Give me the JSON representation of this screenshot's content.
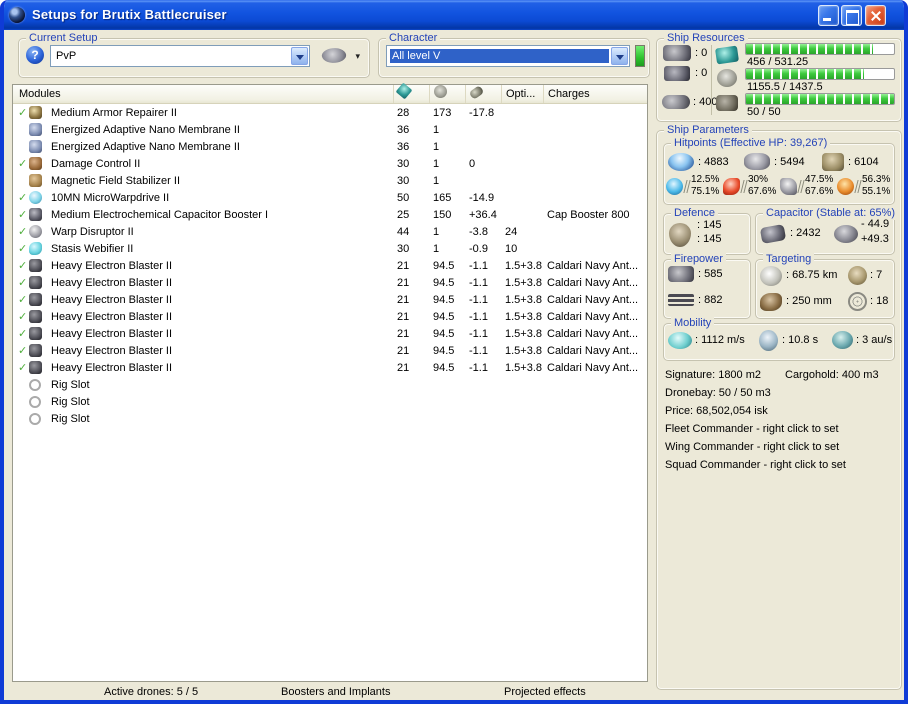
{
  "glyphs": {
    "help": "?",
    "check": "✓",
    "caret": "▾"
  },
  "window": {
    "title": "Setups for Brutix Battlecruiser"
  },
  "current_setup": {
    "label": "Current Setup",
    "value": "PvP"
  },
  "character": {
    "label": "Character",
    "value": "All level V"
  },
  "modules_table": {
    "header": {
      "modules": "Modules",
      "opti": "Opti...",
      "charges": "Charges"
    },
    "rows": [
      {
        "fitted": true,
        "icon": "armor-repairer",
        "name": "Medium Armor Repairer II",
        "cpu": "28",
        "pg": "173",
        "cap": "-17.8",
        "opti": "",
        "charge": ""
      },
      {
        "fitted": false,
        "icon": "nano-membrane",
        "name": "Energized Adaptive Nano Membrane II",
        "cpu": "36",
        "pg": "1",
        "cap": "",
        "opti": "",
        "charge": ""
      },
      {
        "fitted": false,
        "icon": "nano-membrane",
        "name": "Energized Adaptive Nano Membrane II",
        "cpu": "36",
        "pg": "1",
        "cap": "",
        "opti": "",
        "charge": ""
      },
      {
        "fitted": true,
        "icon": "damage-control",
        "name": "Damage Control II",
        "cpu": "30",
        "pg": "1",
        "cap": "0",
        "opti": "",
        "charge": ""
      },
      {
        "fitted": false,
        "icon": "mag-stab",
        "name": "Magnetic Field Stabilizer II",
        "cpu": "30",
        "pg": "1",
        "cap": "",
        "opti": "",
        "charge": ""
      },
      {
        "fitted": true,
        "icon": "mwd",
        "name": "10MN MicroWarpdrive II",
        "cpu": "50",
        "pg": "165",
        "cap": "-14.9",
        "opti": "",
        "charge": ""
      },
      {
        "fitted": true,
        "icon": "cap-booster",
        "name": "Medium Electrochemical Capacitor Booster I",
        "cpu": "25",
        "pg": "150",
        "cap": "+36.4",
        "opti": "",
        "charge": "Cap Booster 800"
      },
      {
        "fitted": true,
        "icon": "warp-disruptor",
        "name": "Warp Disruptor II",
        "cpu": "44",
        "pg": "1",
        "cap": "-3.8",
        "opti": "24",
        "charge": ""
      },
      {
        "fitted": true,
        "icon": "stasis-web",
        "name": "Stasis Webifier II",
        "cpu": "30",
        "pg": "1",
        "cap": "-0.9",
        "opti": "10",
        "charge": ""
      },
      {
        "fitted": true,
        "icon": "blaster",
        "name": "Heavy Electron Blaster II",
        "cpu": "21",
        "pg": "94.5",
        "cap": "-1.1",
        "opti": "1.5+3.8",
        "charge": "Caldari Navy Ant..."
      },
      {
        "fitted": true,
        "icon": "blaster",
        "name": "Heavy Electron Blaster II",
        "cpu": "21",
        "pg": "94.5",
        "cap": "-1.1",
        "opti": "1.5+3.8",
        "charge": "Caldari Navy Ant..."
      },
      {
        "fitted": true,
        "icon": "blaster",
        "name": "Heavy Electron Blaster II",
        "cpu": "21",
        "pg": "94.5",
        "cap": "-1.1",
        "opti": "1.5+3.8",
        "charge": "Caldari Navy Ant..."
      },
      {
        "fitted": true,
        "icon": "blaster",
        "name": "Heavy Electron Blaster II",
        "cpu": "21",
        "pg": "94.5",
        "cap": "-1.1",
        "opti": "1.5+3.8",
        "charge": "Caldari Navy Ant..."
      },
      {
        "fitted": true,
        "icon": "blaster",
        "name": "Heavy Electron Blaster II",
        "cpu": "21",
        "pg": "94.5",
        "cap": "-1.1",
        "opti": "1.5+3.8",
        "charge": "Caldari Navy Ant..."
      },
      {
        "fitted": true,
        "icon": "blaster",
        "name": "Heavy Electron Blaster II",
        "cpu": "21",
        "pg": "94.5",
        "cap": "-1.1",
        "opti": "1.5+3.8",
        "charge": "Caldari Navy Ant..."
      },
      {
        "fitted": true,
        "icon": "blaster",
        "name": "Heavy Electron Blaster II",
        "cpu": "21",
        "pg": "94.5",
        "cap": "-1.1",
        "opti": "1.5+3.8",
        "charge": "Caldari Navy Ant..."
      },
      {
        "fitted": false,
        "icon": "rig-slot",
        "name": "Rig Slot",
        "cpu": "",
        "pg": "",
        "cap": "",
        "opti": "",
        "charge": ""
      },
      {
        "fitted": false,
        "icon": "rig-slot",
        "name": "Rig Slot",
        "cpu": "",
        "pg": "",
        "cap": "",
        "opti": "",
        "charge": ""
      },
      {
        "fitted": false,
        "icon": "rig-slot",
        "name": "Rig Slot",
        "cpu": "",
        "pg": "",
        "cap": "",
        "opti": "",
        "charge": ""
      }
    ]
  },
  "ship_resources": {
    "label": "Ship Resources",
    "turrets": ": 0",
    "launchers": ": 0",
    "calibration": ": 400",
    "bars": [
      {
        "name": "cpu",
        "text": "456 / 531.25",
        "pct": 86
      },
      {
        "name": "powergrid",
        "text": "1155.5 / 1437.5",
        "pct": 80
      },
      {
        "name": "drone-bandwidth",
        "text": "50 / 50",
        "pct": 100
      }
    ]
  },
  "ship_parameters": {
    "label": "Ship Parameters",
    "hitpoints": {
      "label": "Hitpoints (Effective HP: 39,267)",
      "shield": ": 4883",
      "armor": ": 5494",
      "hull": ": 6104",
      "resists": [
        {
          "type": "em",
          "shield": "12.5%",
          "armor": "75.1%"
        },
        {
          "type": "thermal",
          "shield": "30%",
          "armor": "67.6%"
        },
        {
          "type": "kinetic",
          "shield": "47.5%",
          "armor": "67.6%"
        },
        {
          "type": "explosive",
          "shield": "56.3%",
          "armor": "55.1%"
        }
      ]
    },
    "defence": {
      "label": "Defence",
      "v1": ": 145",
      "v2": ": 145"
    },
    "capacitor": {
      "label": "Capacitor (Stable at: 65%)",
      "amount": ": 2432",
      "drain": "- 44.9",
      "recharge": "+49.3"
    },
    "firepower": {
      "label": "Firepower",
      "dps": ": 585",
      "volley": ": 882"
    },
    "targeting": {
      "label": "Targeting",
      "range": ": 68.75 km",
      "max_targets": ": 7",
      "scan_res": ": 250 mm",
      "sensor_str": ": 18"
    },
    "mobility": {
      "label": "Mobility",
      "speed": ": 1112 m/s",
      "align": ": 10.8 s",
      "warp": ": 3 au/s"
    },
    "info": {
      "signature": "Signature: 1800 m2",
      "cargohold": "Cargohold: 400 m3",
      "dronebay": "Dronebay: 50 / 50 m3",
      "price": "Price: 68,502,054 isk",
      "fleet": "Fleet Commander - right click to set",
      "wing": "Wing Commander - right click to set",
      "squad": "Squad Commander - right click to set"
    }
  },
  "bottom_bar": {
    "active_drones": "Active drones: 5 / 5",
    "boosters": "Boosters and Implants",
    "projected": "Projected effects"
  }
}
